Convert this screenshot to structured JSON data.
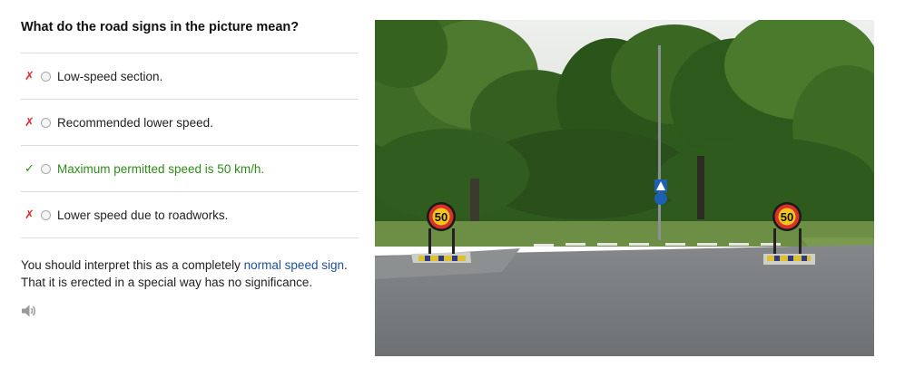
{
  "question": "What do the road signs in the picture mean?",
  "options": [
    {
      "mark": "✗",
      "label": "Low-speed section.",
      "correct": false
    },
    {
      "mark": "✗",
      "label": "Recommended lower speed.",
      "correct": false
    },
    {
      "mark": "✓",
      "label": "Maximum permitted speed is 50 km/h.",
      "correct": true
    },
    {
      "mark": "✗",
      "label": "Lower speed due to roadworks.",
      "correct": false
    }
  ],
  "explanation": {
    "prefix": "You should interpret this as a completely ",
    "link": "normal speed sign",
    "suffix": ".",
    "line2": "That it is erected in a special way has no significance."
  },
  "signs": {
    "left_value": "50",
    "right_value": "50"
  },
  "icons": {
    "audio": "speaker-icon",
    "wrong": "cross-icon",
    "right": "check-icon"
  },
  "colors": {
    "correct": "#2f8a1a",
    "wrong": "#e02b2b",
    "link": "#1f4f9a"
  }
}
